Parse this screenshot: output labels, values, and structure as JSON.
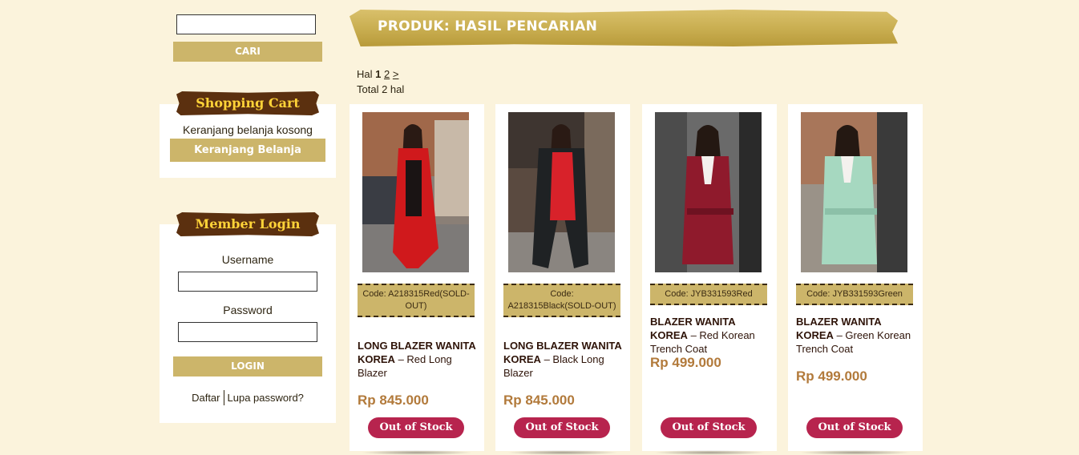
{
  "search": {
    "button_label": "CARI",
    "value": ""
  },
  "cart": {
    "title": "Shopping Cart",
    "empty_text": "Keranjang belanja kosong",
    "button_label": "Keranjang Belanja"
  },
  "login": {
    "title": "Member Login",
    "username_label": "Username",
    "password_label": "Password",
    "button_label": "LOGIN",
    "register_link": "Daftar",
    "forgot_link": "Lupa password?"
  },
  "main": {
    "title": "PRODUK: HASIL PENCARIAN",
    "pager": {
      "prefix": "Hal",
      "current": "1",
      "next_page": "2",
      "next_arrow": ">",
      "total": "Total 2 hal"
    }
  },
  "products": [
    {
      "code": "Code: A218315Red(SOLD-OUT)",
      "name_bold": "LONG BLAZER WANITA KOREA",
      "name_rest": " – Red Long Blazer",
      "price": "Rp 845.000",
      "status": "Out of Stock"
    },
    {
      "code": "Code: A218315Black(SOLD-OUT)",
      "name_bold": "LONG BLAZER WANITA KOREA",
      "name_rest": " – Black Long Blazer",
      "price": "Rp 845.000",
      "status": "Out of Stock"
    },
    {
      "code": "Code: JYB331593Red",
      "name_bold": "BLAZER WANITA KOREA",
      "name_rest": " – Red Korean Trench Coat",
      "price": "Rp 499.000",
      "status": "Out of Stock"
    },
    {
      "code": "Code: JYB331593Green",
      "name_bold": "BLAZER WANITA KOREA",
      "name_rest": " – Green Korean Trench Coat",
      "price": "Rp 499.000",
      "status": "Out of Stock"
    }
  ],
  "colors": {
    "accent_gold": "#ccb56a",
    "ribbon_brown": "#5b300f",
    "ribbon_text": "#ffd338",
    "price": "#b27a3b",
    "out_of_stock": "#b7244e"
  }
}
